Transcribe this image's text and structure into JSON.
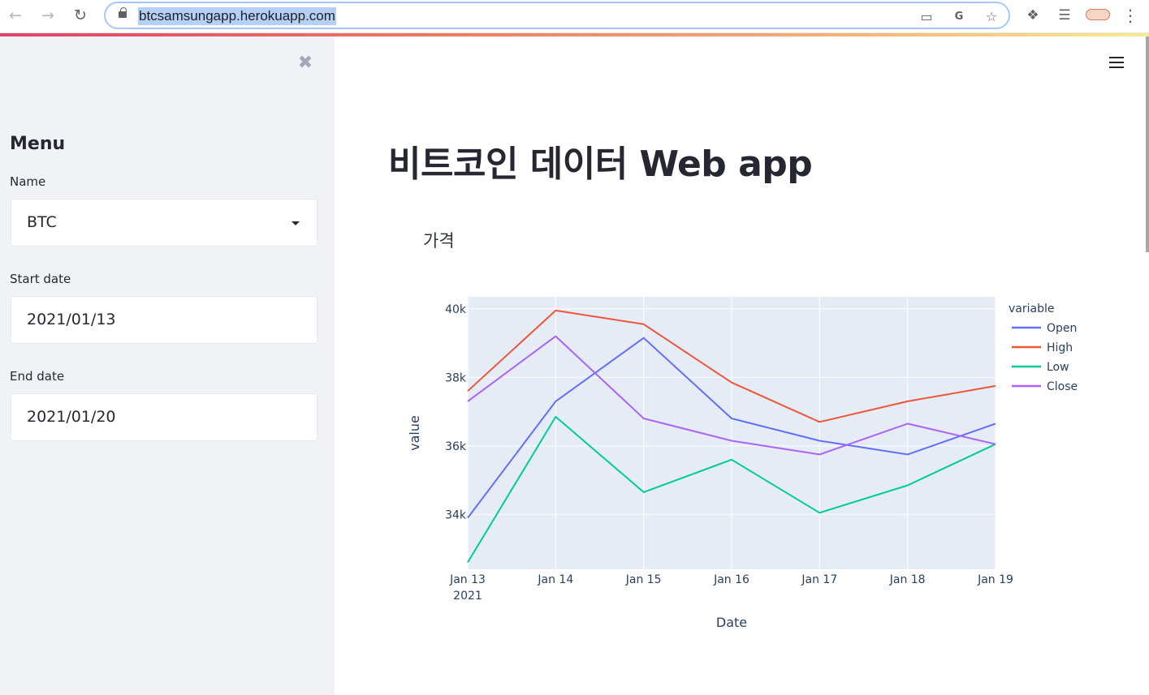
{
  "browser": {
    "url": "btcsamsungapp.herokuapp.com",
    "icons": [
      "back-arrow-icon",
      "forward-arrow-icon",
      "reload-icon",
      "lock-icon",
      "cast-icon",
      "translate-icon",
      "star-icon",
      "puzzle-icon",
      "media-playlist-icon",
      "profile-icon",
      "kebab-menu-icon"
    ]
  },
  "sidebar": {
    "title": "Menu",
    "fields": [
      {
        "label": "Name",
        "value": "BTC"
      },
      {
        "label": "Start date",
        "value": "2021/01/13"
      },
      {
        "label": "End date",
        "value": "2021/01/20"
      }
    ]
  },
  "main": {
    "title": "비트코인 데이터 Web app",
    "section_label": "가격"
  },
  "chart_data": {
    "type": "line",
    "xlabel": "Date",
    "ylabel": "value",
    "legend_title": "variable",
    "legend_position": "top-right",
    "x": [
      "2021-01-13",
      "2021-01-14",
      "2021-01-15",
      "2021-01-16",
      "2021-01-17",
      "2021-01-18",
      "2021-01-19"
    ],
    "x_tick_labels": [
      "Jan 13",
      "Jan 14",
      "Jan 15",
      "Jan 16",
      "Jan 17",
      "Jan 18",
      "Jan 19"
    ],
    "x_tick_year": "2021",
    "y_ticks": [
      34000,
      36000,
      38000,
      40000
    ],
    "y_tick_labels": [
      "34k",
      "36k",
      "38k",
      "40k"
    ],
    "ylim": [
      32400,
      40350
    ],
    "grid": true,
    "plot_bg": "#e5ecf6",
    "series": [
      {
        "name": "Open",
        "color": "#636efa",
        "values": [
          33900,
          37300,
          39150,
          36800,
          36150,
          35750,
          36650
        ]
      },
      {
        "name": "High",
        "color": "#ef553b",
        "values": [
          37600,
          39950,
          39550,
          37850,
          36700,
          37300,
          37750
        ]
      },
      {
        "name": "Low",
        "color": "#00cc96",
        "values": [
          32600,
          36850,
          34650,
          35600,
          34050,
          34850,
          36050
        ]
      },
      {
        "name": "Close",
        "color": "#ab63fa",
        "values": [
          37300,
          39200,
          36800,
          36150,
          35750,
          36650,
          36050
        ]
      }
    ]
  }
}
